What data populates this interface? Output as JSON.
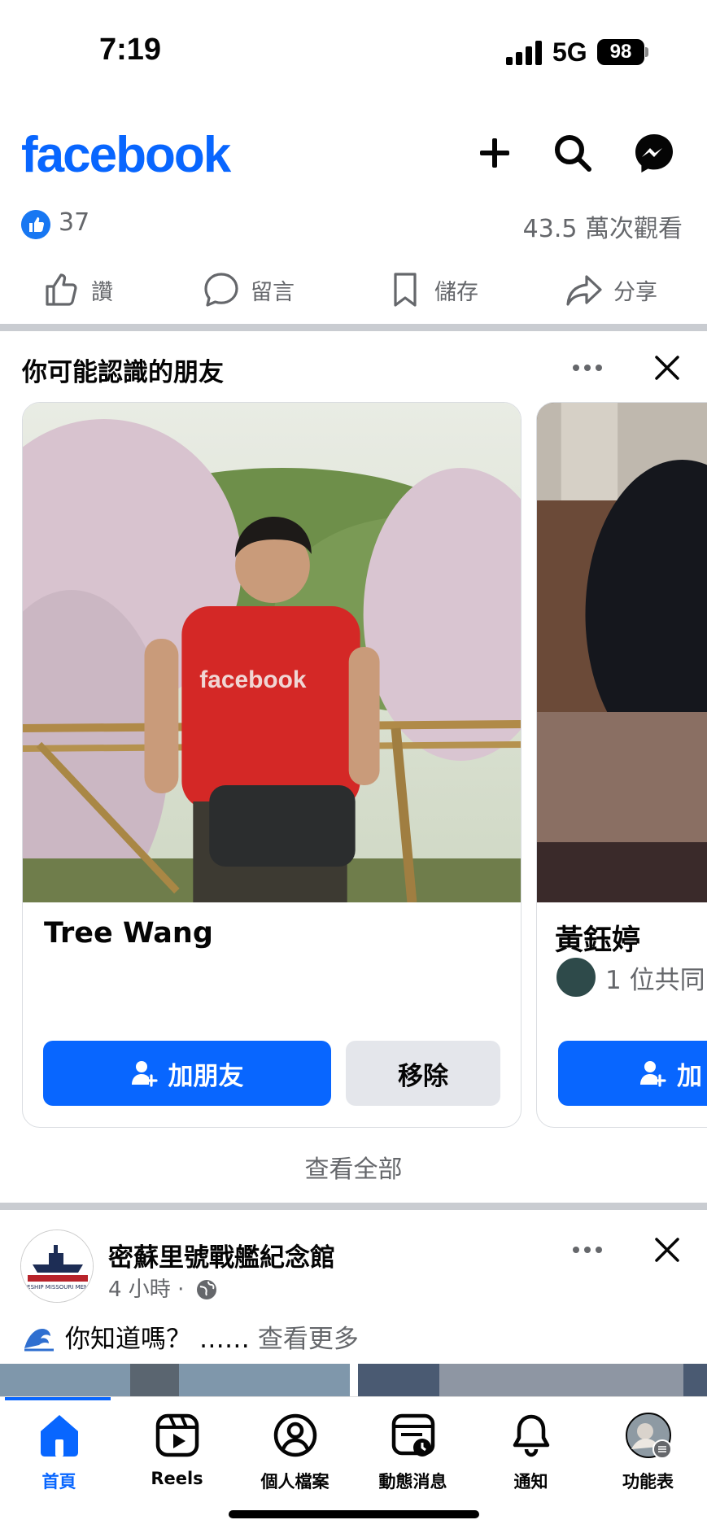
{
  "status": {
    "time": "7:19",
    "network": "5G",
    "battery": "98"
  },
  "header": {
    "logo": "facebook",
    "icons": [
      "plus-icon",
      "search-icon",
      "messenger-icon"
    ]
  },
  "prev_post": {
    "like_count": "37",
    "views": "43.5 萬次觀看"
  },
  "actions": {
    "like": "讚",
    "comment": "留言",
    "save": "儲存",
    "share": "分享"
  },
  "pymk": {
    "title": "你可能認識的朋友",
    "cards": [
      {
        "name": "Tree Wang",
        "mutual": "",
        "add_label": "加朋友",
        "remove_label": "移除"
      },
      {
        "name": "黃鈺婷",
        "mutual": "1 位共同",
        "add_label": "加"
      }
    ],
    "see_all": "查看全部"
  },
  "post": {
    "page_name": "密蘇里號戰艦紀念館",
    "time": "4 小時 ·",
    "text": "你知道嗎？ ……",
    "see_more": "查看更多",
    "avatar_text": "BATTLESHIP MISSOURI MEMORIAL"
  },
  "tabs": [
    {
      "label": "首頁",
      "icon": "home-icon",
      "active": true
    },
    {
      "label": "Reels",
      "icon": "reels-icon",
      "active": false
    },
    {
      "label": "個人檔案",
      "icon": "profile-icon",
      "active": false
    },
    {
      "label": "動態消息",
      "icon": "feed-icon",
      "active": false
    },
    {
      "label": "通知",
      "icon": "bell-icon",
      "active": false
    },
    {
      "label": "功能表",
      "icon": "menu-avatar-icon",
      "active": false
    }
  ],
  "colors": {
    "brand": "#0866ff",
    "secondary_text": "#65676b",
    "separator": "#c9ccd1"
  }
}
